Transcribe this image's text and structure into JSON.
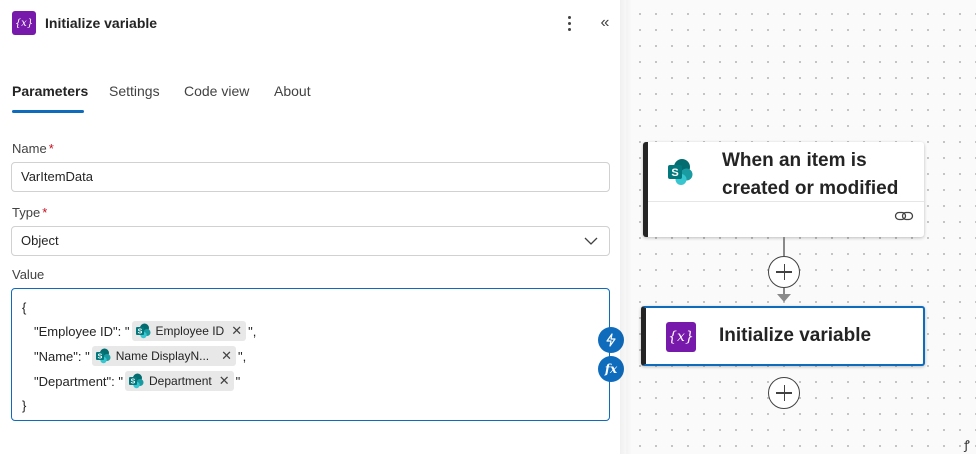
{
  "panel": {
    "icon_text": "{x}",
    "title": "Initialize variable",
    "tabs": [
      {
        "label": "Parameters"
      },
      {
        "label": "Settings"
      },
      {
        "label": "Code view"
      },
      {
        "label": "About"
      }
    ],
    "name_label": "Name",
    "name_value": "VarItemData",
    "type_label": "Type",
    "type_value": "Object",
    "value_label": "Value",
    "required_mark": "*",
    "value_lines": {
      "open": "{",
      "l1_key": "\"Employee ID\": \"",
      "l1_token": "Employee ID",
      "l1_end": "\",",
      "l2_key": "\"Name\": \"",
      "l2_token": "Name DisplayN...",
      "l2_end": "\",",
      "l3_key": "\"Department\": \"",
      "l3_token": "Department",
      "l3_end": "\"",
      "close": "}"
    },
    "token_close": "✕",
    "fx_label": "fx",
    "colors": {
      "accent": "#0f6cbd",
      "variable": "#7719aa",
      "required": "#c50f1f"
    }
  },
  "canvas": {
    "trigger_title": "When an item is created or modified",
    "action_icon_text": "{x}",
    "action_title": "Initialize variable",
    "corner_mark": "ꝭ"
  }
}
